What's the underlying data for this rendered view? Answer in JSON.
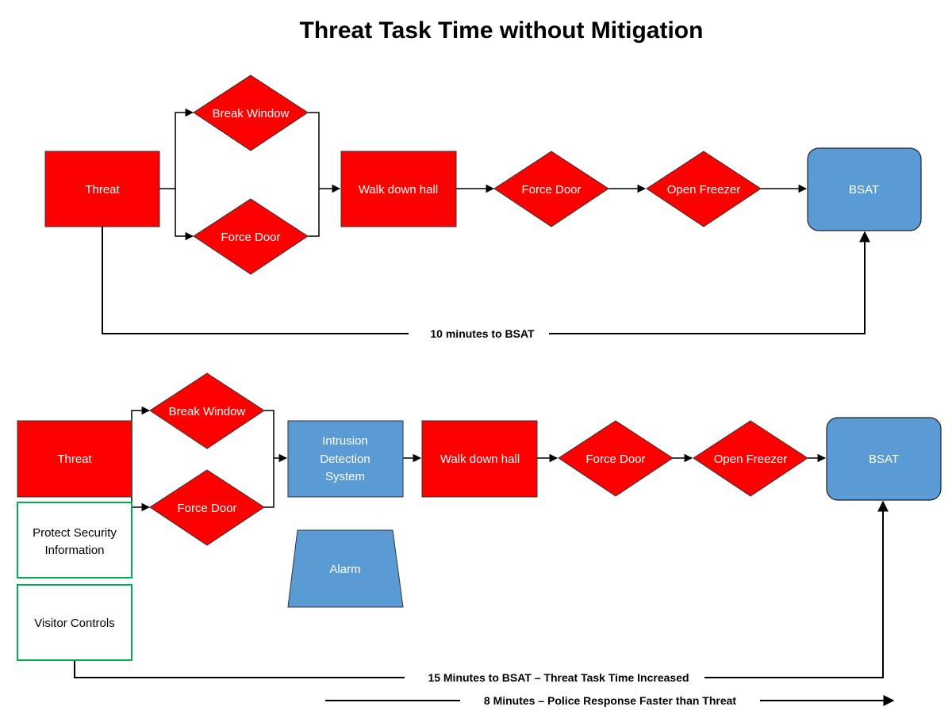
{
  "title": "Threat Task Time without Mitigation",
  "colors": {
    "threat_red": "#ff0000",
    "mitigation_blue": "#5b9bd5",
    "control_green": "#00b050"
  },
  "top_flow": {
    "threat": "Threat",
    "branch_upper": "Break Window",
    "branch_lower": "Force Door",
    "walk": "Walk down hall",
    "force_door": "Force Door",
    "open_freezer": "Open Freezer",
    "target": "BSAT",
    "timeline_label": "10 minutes to BSAT"
  },
  "bottom_flow": {
    "threat": "Threat",
    "controls": [
      "Protect Security",
      "Information",
      "Visitor Controls"
    ],
    "branch_upper": "Break Window",
    "branch_lower": "Force Door",
    "ids": [
      "Intrusion",
      "Detection",
      "System"
    ],
    "alarm": "Alarm",
    "walk": "Walk down hall",
    "force_door": "Force Door",
    "open_freezer": "Open Freezer",
    "target": "BSAT",
    "timeline_label": "15 Minutes to BSAT – Threat Task Time Increased",
    "police_label": "8 Minutes – Police Response Faster than Threat"
  }
}
